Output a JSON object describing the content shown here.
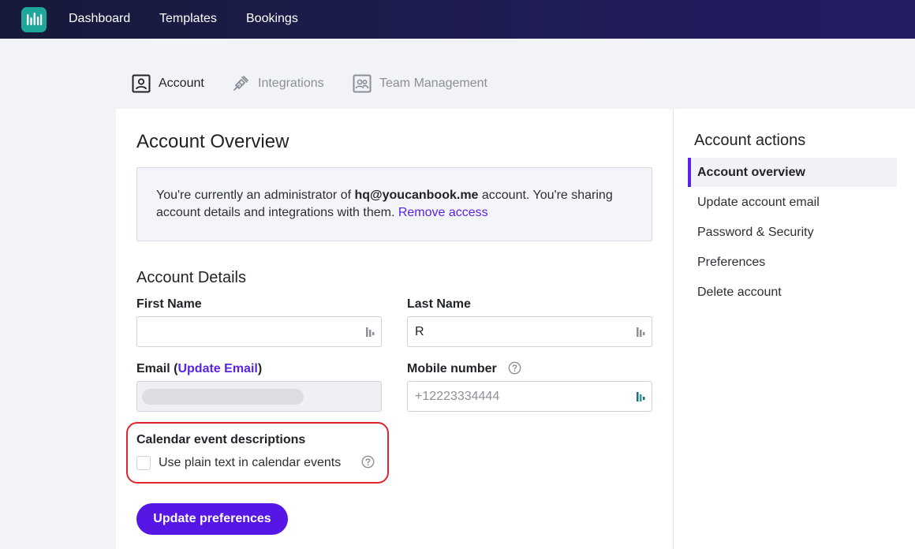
{
  "nav": {
    "items": [
      "Dashboard",
      "Templates",
      "Bookings"
    ]
  },
  "tabs": [
    {
      "label": "Account",
      "icon": "account-icon",
      "active": true
    },
    {
      "label": "Integrations",
      "icon": "plug-icon",
      "active": false
    },
    {
      "label": "Team Management",
      "icon": "team-icon",
      "active": false
    }
  ],
  "overview": {
    "title": "Account Overview",
    "notice_prefix": "You're currently an administrator of ",
    "notice_account": "hq@youcanbook.me",
    "notice_suffix": " account. You're sharing account details and integrations with them. ",
    "remove_access": "Remove access"
  },
  "details": {
    "title": "Account Details",
    "first_name_label": "First Name",
    "first_name_value": "",
    "last_name_label": "Last Name",
    "last_name_value": "R",
    "email_label_prefix": "Email (",
    "email_label_link": "Update Email",
    "email_label_suffix": ")",
    "mobile_label": "Mobile number",
    "mobile_placeholder": "+12223334444"
  },
  "calendar": {
    "title": "Calendar event descriptions",
    "checkbox_label": "Use plain text in calendar events",
    "checked": false
  },
  "update_button": "Update preferences",
  "sidebar": {
    "title": "Account actions",
    "items": [
      {
        "label": "Account overview",
        "active": true
      },
      {
        "label": "Update account email",
        "active": false
      },
      {
        "label": "Password & Security",
        "active": false
      },
      {
        "label": "Preferences",
        "active": false
      },
      {
        "label": "Delete account",
        "active": false
      }
    ]
  },
  "colors": {
    "accent": "#5516e6",
    "link": "#5a22e6",
    "brand": "#20a79b",
    "highlight": "#e0262d"
  }
}
